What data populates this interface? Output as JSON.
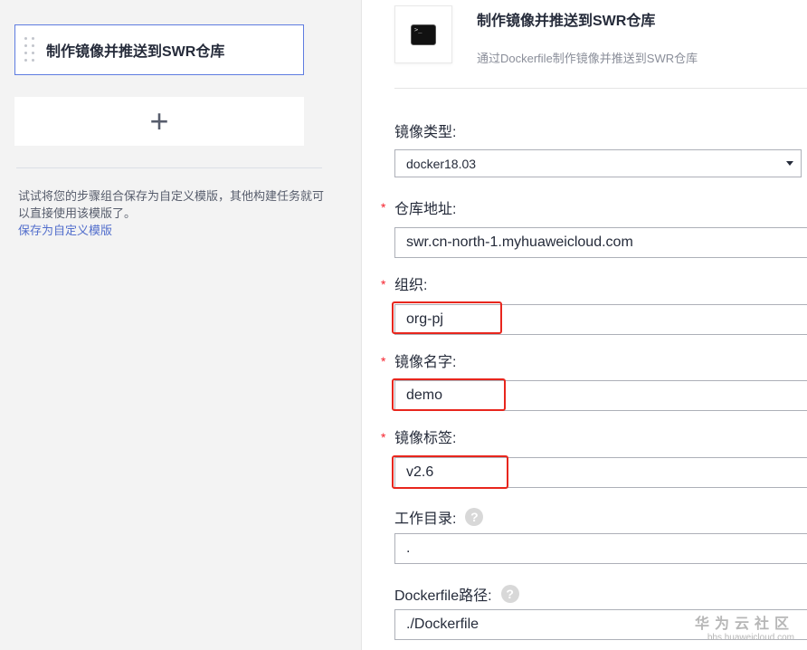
{
  "left": {
    "step_title": "制作镜像并推送到SWR仓库",
    "hint_text": "试试将您的步骤组合保存为自定义模版，其他构建任务就可以直接使用该模版了。",
    "hint_link": "保存为自定义模版"
  },
  "header": {
    "title": "制作镜像并推送到SWR仓库",
    "description": "通过Dockerfile制作镜像并推送到SWR仓库",
    "icon": "terminal-icon"
  },
  "form": {
    "image_type_label": "镜像类型:",
    "image_type_value": "docker18.03",
    "repo_label": "仓库地址:",
    "repo_value": "swr.cn-north-1.myhuaweicloud.com",
    "org_label": "组织:",
    "org_value": "org-pj",
    "name_label": "镜像名字:",
    "name_value": "demo",
    "tag_label": "镜像标签:",
    "tag_value": "v2.6",
    "workdir_label": "工作目录:",
    "workdir_value": ".",
    "dockerfile_label": "Dockerfile路径:",
    "dockerfile_value": "./Dockerfile",
    "required_mark": "*",
    "help_mark": "?"
  },
  "watermark": {
    "main": "华为云社区",
    "sub": "bbs.huaweicloud.com"
  },
  "colors": {
    "accent": "#5e7ce0",
    "highlight": "#e8261d",
    "required": "#f5222d"
  }
}
